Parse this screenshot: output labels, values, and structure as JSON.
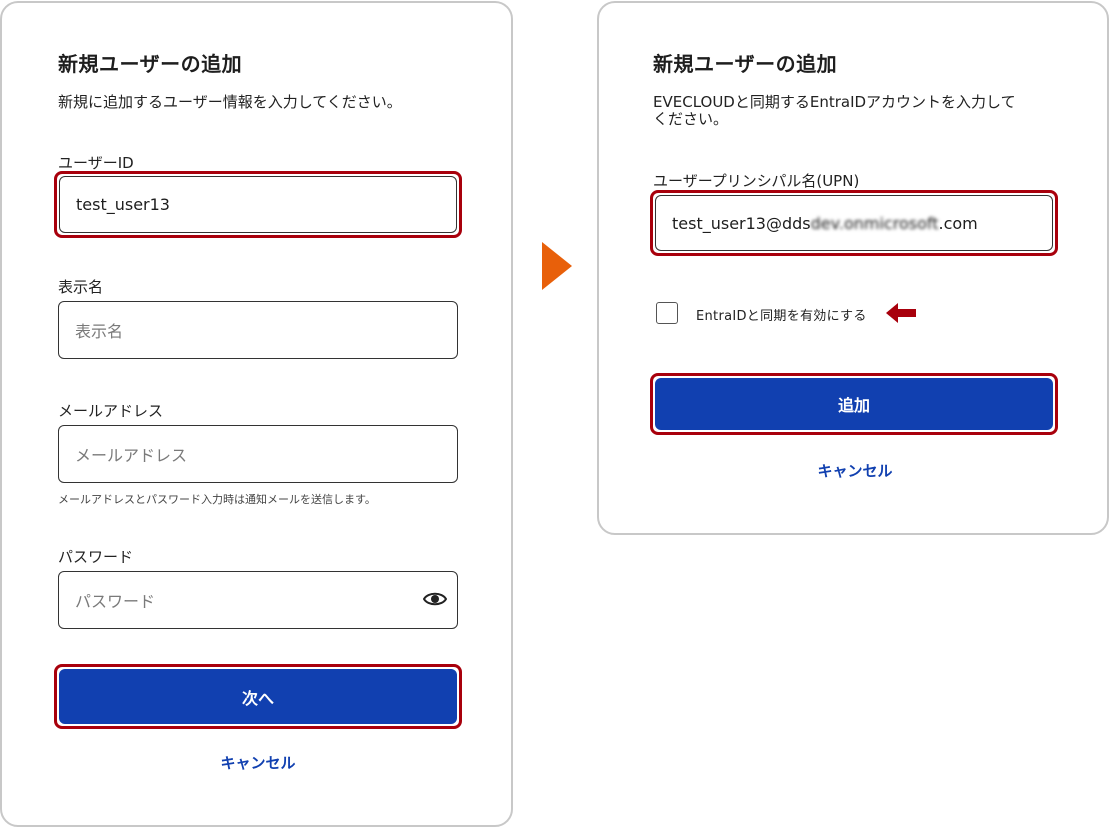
{
  "left_panel": {
    "title": "新規ユーザーの追加",
    "description": "新規に追加するユーザー情報を入力してください。",
    "user_id": {
      "label": "ユーザーID",
      "value": "test_user13"
    },
    "display_name": {
      "label": "表示名",
      "placeholder": "表示名"
    },
    "email": {
      "label": "メールアドレス",
      "placeholder": "メールアドレス",
      "help": "メールアドレスとパスワード入力時は通知メールを送信します。"
    },
    "password": {
      "label": "パスワード",
      "placeholder": "パスワード",
      "toggle_icon": "eye-icon"
    },
    "next_button": "次へ",
    "cancel_link": "キャンセル"
  },
  "right_panel": {
    "title": "新規ユーザーの追加",
    "description_line1": "EVECLOUDと同期するEntraIDアカウントを入力して",
    "description_line2": "ください。",
    "upn": {
      "label": "ユーザープリンシパル名(UPN)",
      "value_prefix": "test_user13@dds",
      "value_blurred": "dev.onmicrosoft",
      "value_suffix": ".com"
    },
    "sync_checkbox": {
      "label": "EntraIDと同期を有効にする",
      "checked": false
    },
    "add_button": "追加",
    "cancel_link": "キャンセル"
  },
  "colors": {
    "accent_blue": "#1140b0",
    "highlight_red": "#a8000c",
    "flow_arrow_orange": "#e8600a",
    "panel_border": "#c8c8c8"
  }
}
